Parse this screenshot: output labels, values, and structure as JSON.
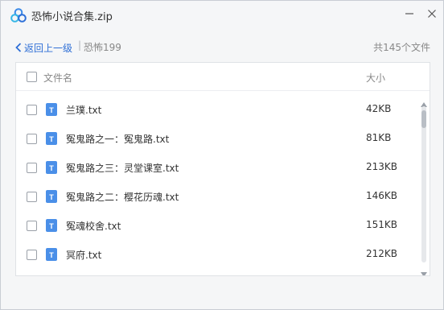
{
  "window": {
    "title": "恐怖小说合集.zip"
  },
  "nav": {
    "back_label": "返回上一级",
    "separator": "|",
    "current_folder": "恐怖199",
    "file_count": "共145个文件"
  },
  "table": {
    "header_name": "文件名",
    "header_size": "大小",
    "rows": [
      {
        "name": "兰璞.txt",
        "size": "42KB",
        "icon": "text-file-icon"
      },
      {
        "name": "冤鬼路之一：冤鬼路.txt",
        "size": "81KB",
        "icon": "text-file-icon"
      },
      {
        "name": "冤鬼路之三：灵堂课室.txt",
        "size": "213KB",
        "icon": "text-file-icon"
      },
      {
        "name": "冤鬼路之二：樱花历魂.txt",
        "size": "146KB",
        "icon": "text-file-icon"
      },
      {
        "name": "冤魂校舍.txt",
        "size": "151KB",
        "icon": "text-file-icon"
      },
      {
        "name": "冥府.txt",
        "size": "212KB",
        "icon": "text-file-icon"
      }
    ]
  },
  "colors": {
    "accent": "#2f6fd6",
    "file_icon": "#4a8fe8"
  }
}
